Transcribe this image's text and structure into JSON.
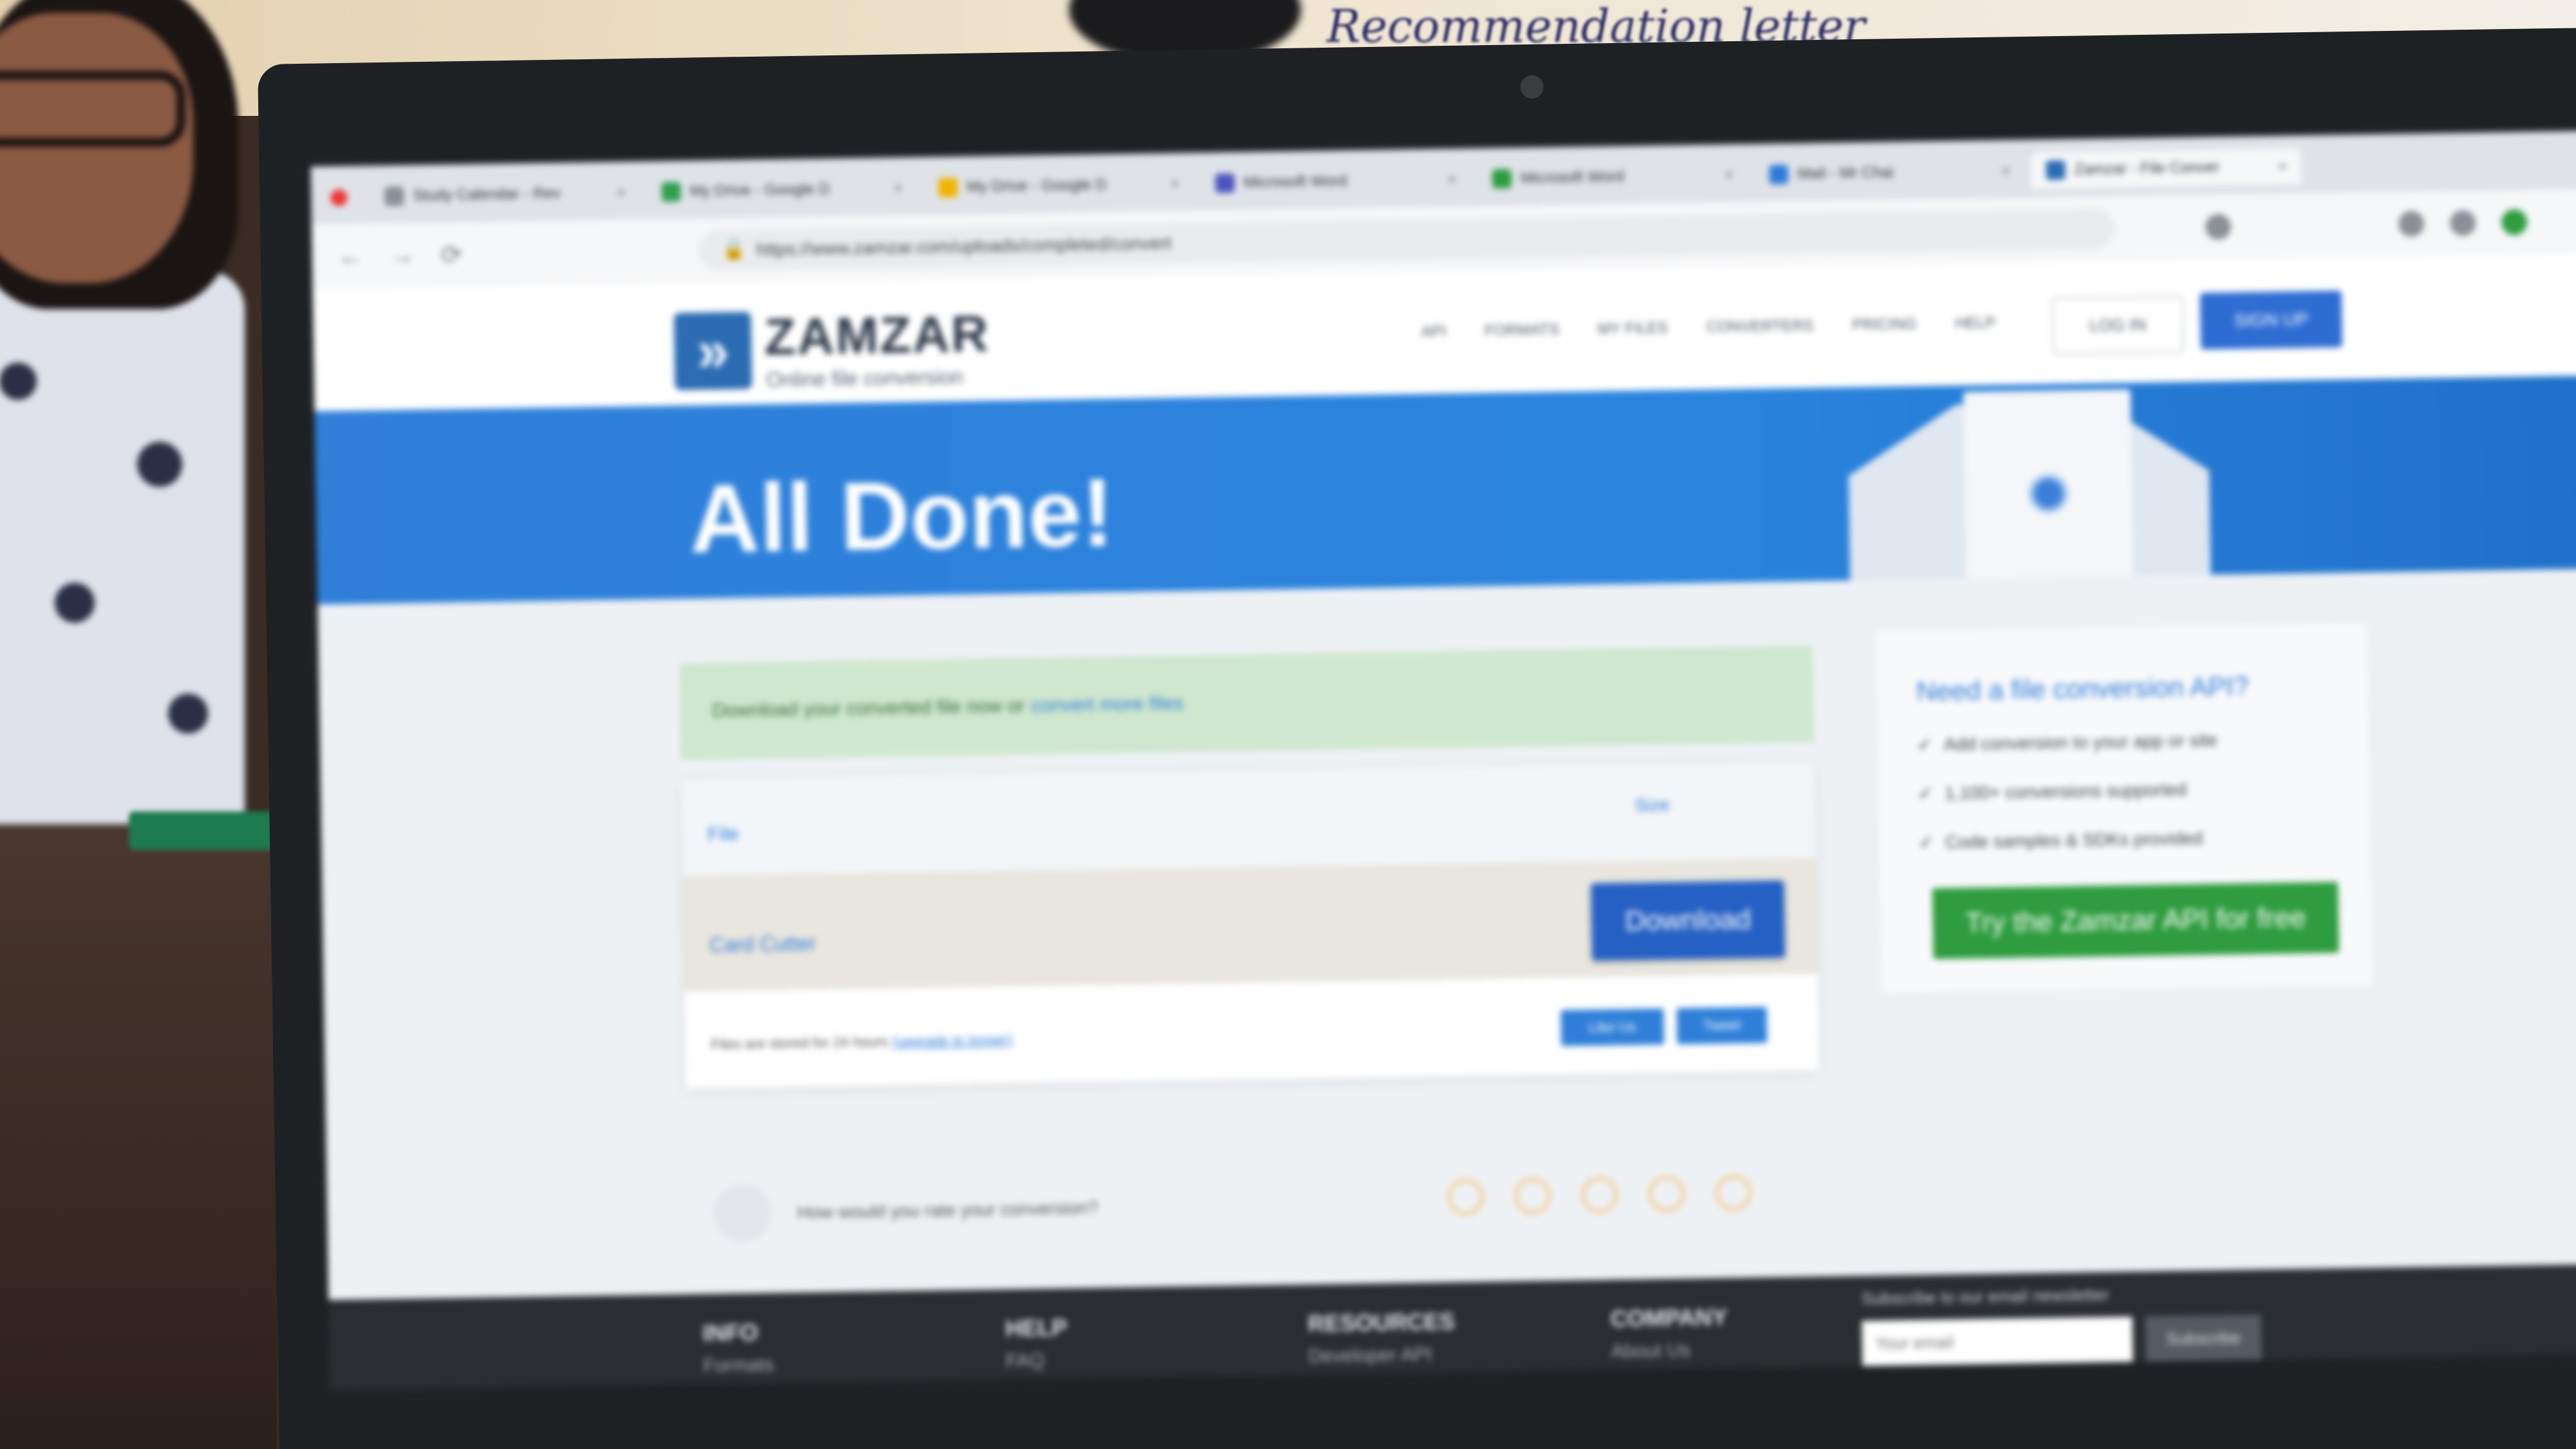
{
  "wall_note": "Recommendation letter",
  "browser": {
    "tabs": [
      {
        "label": "Study Calendar - Rev",
        "color": "#8a8f96"
      },
      {
        "label": "My Drive - Google D",
        "color": "#2f9e4f"
      },
      {
        "label": "My Drive - Google D",
        "color": "#f0b400"
      },
      {
        "label": "Microsoft Word",
        "color": "#4b53bc"
      },
      {
        "label": "Microsoft Word",
        "color": "#2e9c3f"
      },
      {
        "label": "Mail - Mr Chai",
        "color": "#2f7bd9"
      },
      {
        "label": "Zamzar - File Conver",
        "color": "#2b6cb3"
      }
    ],
    "url": "https://www.zamzar.com/uploads/completed/convert",
    "back_icon": "arrow-left-icon",
    "forward_icon": "arrow-right-icon",
    "reload_icon": "reload-icon"
  },
  "site": {
    "logo_text": "ZAMZAR",
    "logo_tagline": "Online file conversion",
    "nav": [
      "API",
      "FORMATS",
      "MY FILES",
      "CONVERTERS",
      "PRICING",
      "HELP"
    ],
    "login": "LOG IN",
    "signup": "SIGN UP"
  },
  "banner": {
    "title": "All Done!"
  },
  "main": {
    "success_text": "Download your converted file now or",
    "success_link": "convert more files",
    "file_name": "File",
    "file_size": "Size",
    "file_label": "Card Cutter",
    "download_label": "Download",
    "footnote": "Files are stored for 24 hours",
    "footnote_link": "(upgrade to longer)",
    "share_1": "Like Us",
    "share_2": "Tweet",
    "rating_question": "How would you rate your conversion?",
    "stars": 5
  },
  "api": {
    "title": "Need a file conversion API?",
    "items": [
      "Add conversion to your app or site",
      "1,100+ conversions supported",
      "Code samples & SDKs provided"
    ],
    "button": "Try the Zamzar API for free"
  },
  "footer": {
    "cols": [
      {
        "title": "INFO",
        "link": "Formats"
      },
      {
        "title": "HELP",
        "link": "FAQ"
      },
      {
        "title": "RESOURCES",
        "link": "Developer API"
      },
      {
        "title": "COMPANY",
        "link": "About Us"
      }
    ],
    "newsletter_label": "Subscribe to our email newsletter",
    "email_placeholder": "Your email",
    "subscribe": "Subscribe"
  }
}
